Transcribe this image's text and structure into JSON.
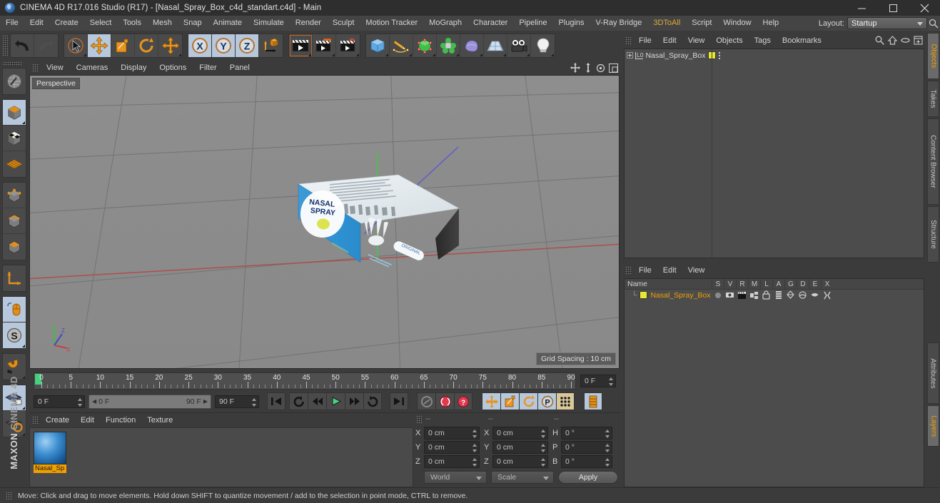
{
  "window": {
    "title": "CINEMA 4D R17.016 Studio (R17) - [Nasal_Spray_Box_c4d_standart.c4d] - Main",
    "logo_icon": "cinema4d-logo-icon",
    "minimize_icon": "minimize-icon",
    "maximize_icon": "maximize-icon",
    "close_icon": "close-icon"
  },
  "menubar": {
    "items": [
      {
        "label": "File"
      },
      {
        "label": "Edit"
      },
      {
        "label": "Create"
      },
      {
        "label": "Select"
      },
      {
        "label": "Tools"
      },
      {
        "label": "Mesh"
      },
      {
        "label": "Snap"
      },
      {
        "label": "Animate"
      },
      {
        "label": "Simulate"
      },
      {
        "label": "Render"
      },
      {
        "label": "Sculpt"
      },
      {
        "label": "Motion Tracker"
      },
      {
        "label": "MoGraph"
      },
      {
        "label": "Character"
      },
      {
        "label": "Pipeline"
      },
      {
        "label": "Plugins"
      },
      {
        "label": "V-Ray Bridge"
      },
      {
        "label": "3DToAll",
        "accent": true
      },
      {
        "label": "Script"
      },
      {
        "label": "Window"
      },
      {
        "label": "Help"
      }
    ],
    "layout_label": "Layout:",
    "layout_value": "Startup",
    "search_icon": "search-icon"
  },
  "toolbar": {
    "groups": [
      {
        "buttons": [
          {
            "name": "undo-button",
            "icon": "undo-arrow-icon"
          },
          {
            "name": "redo-button",
            "icon": "redo-arrow-icon",
            "dim": true
          }
        ]
      },
      {
        "buttons": [
          {
            "name": "live-selection-tool",
            "icon": "cursor-selection-icon",
            "corner": true
          },
          {
            "name": "move-tool",
            "icon": "move-axes-icon",
            "active": true
          },
          {
            "name": "scale-tool",
            "icon": "scale-icon"
          },
          {
            "name": "rotate-tool",
            "icon": "rotate-icon"
          },
          {
            "name": "move-duplicate-tool",
            "icon": "move-axes-icon",
            "corner": true
          }
        ]
      },
      {
        "buttons": [
          {
            "name": "lock-x-axis",
            "icon": "axis-x-icon",
            "active": true
          },
          {
            "name": "lock-y-axis",
            "icon": "axis-y-icon",
            "active": true
          },
          {
            "name": "lock-z-axis",
            "icon": "axis-z-icon",
            "active": true
          },
          {
            "name": "world-object-coordinates",
            "icon": "world-coordinate-icon"
          }
        ]
      },
      {
        "buttons": [
          {
            "name": "render-view",
            "icon": "render-clapper-icon",
            "corner": true
          },
          {
            "name": "render-region",
            "icon": "render-region-icon",
            "corner": true
          },
          {
            "name": "render-settings",
            "icon": "render-settings-icon",
            "corner": true
          }
        ]
      },
      {
        "buttons": [
          {
            "name": "add-cube-object",
            "icon": "cube-primitive-icon",
            "corner": true
          },
          {
            "name": "add-spline",
            "icon": "pen-spline-icon",
            "corner": true
          },
          {
            "name": "add-generator",
            "icon": "green-cube-generator-icon",
            "corner": true
          },
          {
            "name": "add-mograph",
            "icon": "mograph-cloner-icon",
            "corner": true
          },
          {
            "name": "add-deformer",
            "icon": "deformer-bend-icon",
            "corner": true
          },
          {
            "name": "add-scene-object",
            "icon": "environment-floor-icon",
            "corner": true
          },
          {
            "name": "add-camera",
            "icon": "camera-icon",
            "corner": true
          },
          {
            "name": "add-light",
            "icon": "light-bulb-icon",
            "corner": true
          }
        ]
      }
    ]
  },
  "leftbar": {
    "groups": [
      {
        "buttons": [
          {
            "name": "make-editable-button",
            "icon": "make-editable-sphere-icon"
          }
        ]
      },
      {
        "buttons": [
          {
            "name": "model-mode",
            "icon": "model-cube-icon",
            "active": true,
            "corner": true
          },
          {
            "name": "texture-mode",
            "icon": "texture-cube-icon"
          },
          {
            "name": "workplane-mode",
            "icon": "workplane-grid-icon"
          }
        ]
      },
      {
        "buttons": [
          {
            "name": "point-mode",
            "icon": "point-mode-icon"
          },
          {
            "name": "edge-mode",
            "icon": "edge-mode-icon"
          },
          {
            "name": "polygon-mode",
            "icon": "polygon-mode-icon"
          }
        ]
      },
      {
        "buttons": [
          {
            "name": "axis-mode",
            "icon": "axis-modify-icon"
          }
        ]
      },
      {
        "buttons": [
          {
            "name": "viewport-solo-single",
            "icon": "mouse-viewport-icon",
            "active": true
          },
          {
            "name": "enable-snapping",
            "icon": "snap-s-icon",
            "active": true,
            "corner": true
          }
        ]
      },
      {
        "buttons": [
          {
            "name": "magnet-tool",
            "icon": "magnet-icon",
            "corner": true
          }
        ]
      },
      {
        "buttons": [
          {
            "name": "lock-workplane",
            "icon": "workplane-lock-icon",
            "active": true,
            "corner": true
          },
          {
            "name": "planar-workplane",
            "icon": "workplane-rotate-icon",
            "corner": true
          }
        ]
      }
    ],
    "brand_top": "MAXON",
    "brand_bottom": "CINEMA 4D"
  },
  "viewport": {
    "menu": [
      "View",
      "Cameras",
      "Display",
      "Options",
      "Filter",
      "Panel"
    ],
    "perspective_label": "Perspective",
    "grid_spacing_label": "Grid Spacing : 10 cm",
    "header_icons": [
      {
        "name": "pan-viewport-icon"
      },
      {
        "name": "dolly-viewport-icon"
      },
      {
        "name": "rotate-viewport-icon"
      },
      {
        "name": "maximize-viewport-icon"
      }
    ],
    "axis_labels": {
      "x": "X",
      "y": "Y",
      "z": "Z"
    },
    "model": {
      "front_text_line1": "NASAL",
      "front_text_line2": "SPRAY",
      "side_badge": "ORIGINAL"
    }
  },
  "timeline": {
    "ticks": [
      0,
      5,
      10,
      15,
      20,
      25,
      30,
      35,
      40,
      45,
      50,
      55,
      60,
      65,
      70,
      75,
      80,
      85,
      90
    ],
    "current_frame_field": "0 F",
    "start_frame": "0 F",
    "range_start": "0 F",
    "range_end": "90 F",
    "end_frame": "90 F",
    "buttons": [
      {
        "name": "go-to-start-button",
        "icon": "skip-start-icon"
      },
      {
        "name": "play-back-loop-button",
        "icon": "loop-back-icon"
      },
      {
        "name": "step-back-button",
        "icon": "step-back-icon"
      },
      {
        "name": "play-button",
        "icon": "play-icon"
      },
      {
        "name": "step-forward-button",
        "icon": "step-forward-icon"
      },
      {
        "name": "loop-forward-button",
        "icon": "loop-forward-icon"
      },
      {
        "name": "go-to-end-button",
        "icon": "skip-end-icon"
      }
    ],
    "record_buttons": [
      {
        "name": "autokey-button",
        "icon": "autokey-icon"
      },
      {
        "name": "record-active-objects-button",
        "icon": "record-keyframe-icon"
      },
      {
        "name": "record-button",
        "icon": "record-circle-icon"
      }
    ],
    "key_toggles": [
      {
        "name": "position-key-toggle",
        "icon": "position-key-icon"
      },
      {
        "name": "scale-key-toggle",
        "icon": "scale-key-icon"
      },
      {
        "name": "rotation-key-toggle",
        "icon": "rotation-key-icon"
      },
      {
        "name": "parameter-key-toggle",
        "icon": "parameter-key-icon"
      },
      {
        "name": "pla-key-toggle",
        "icon": "pla-key-icon"
      }
    ],
    "keyframe_mode_icon": "keyframe-select-icon"
  },
  "material_manager": {
    "menu": [
      "Create",
      "Edit",
      "Function",
      "Texture"
    ],
    "materials": [
      {
        "name": "Nasal_Spray",
        "label": "Nasal_Sp"
      }
    ]
  },
  "coordinates": {
    "header_placeholders": [
      "--",
      "--",
      "--"
    ],
    "position": {
      "label_x": "X",
      "label_y": "Y",
      "label_z": "Z",
      "x": "0 cm",
      "y": "0 cm",
      "z": "0 cm"
    },
    "size": {
      "label_x": "X",
      "label_y": "Y",
      "label_z": "Z",
      "x": "0 cm",
      "y": "0 cm",
      "z": "0 cm"
    },
    "rotation": {
      "label_h": "H",
      "label_p": "P",
      "label_b": "B",
      "h": "0 °",
      "p": "0 °",
      "b": "0 °"
    },
    "coord_system": "World",
    "transform_mode": "Scale",
    "apply_label": "Apply"
  },
  "object_manager": {
    "menu": [
      "File",
      "Edit",
      "View",
      "Objects",
      "Tags",
      "Bookmarks"
    ],
    "icons": [
      {
        "name": "search-icon"
      },
      {
        "name": "home-arrow-icon"
      },
      {
        "name": "ellipse-icon"
      },
      {
        "name": "add-layer-icon"
      }
    ],
    "rows": [
      {
        "name": "Nasal_Spray_Box",
        "layer_badge": "L0",
        "swatch_color": "#e8e832"
      }
    ]
  },
  "layer_manager": {
    "menu": [
      "File",
      "Edit",
      "View"
    ],
    "columns": [
      "Name",
      "S",
      "V",
      "R",
      "M",
      "L",
      "A",
      "G",
      "D",
      "E",
      "X"
    ],
    "rows": [
      {
        "name": "Nasal_Spray_Box",
        "color": "#e8e832"
      }
    ]
  },
  "vertical_tabs": [
    {
      "label": "Objects",
      "selected": true
    },
    {
      "label": "Takes"
    },
    {
      "label": "Content Browser"
    },
    {
      "label": "Structure"
    },
    {
      "label": "Attributes"
    },
    {
      "label": "Layers",
      "selected": true
    }
  ],
  "statusbar": {
    "message": "Move: Click and drag to move elements. Hold down SHIFT to quantize movement / add to the selection in point mode, CTRL to remove."
  },
  "colors": {
    "accent_orange": "#f0a000",
    "axis_x": "#cc3333",
    "axis_y": "#33bb33",
    "axis_z": "#3344cc",
    "selection_blue": "#b7c8dd",
    "panel_bg": "#3b3b3b",
    "viewport_bg": "#8c8c8c"
  }
}
